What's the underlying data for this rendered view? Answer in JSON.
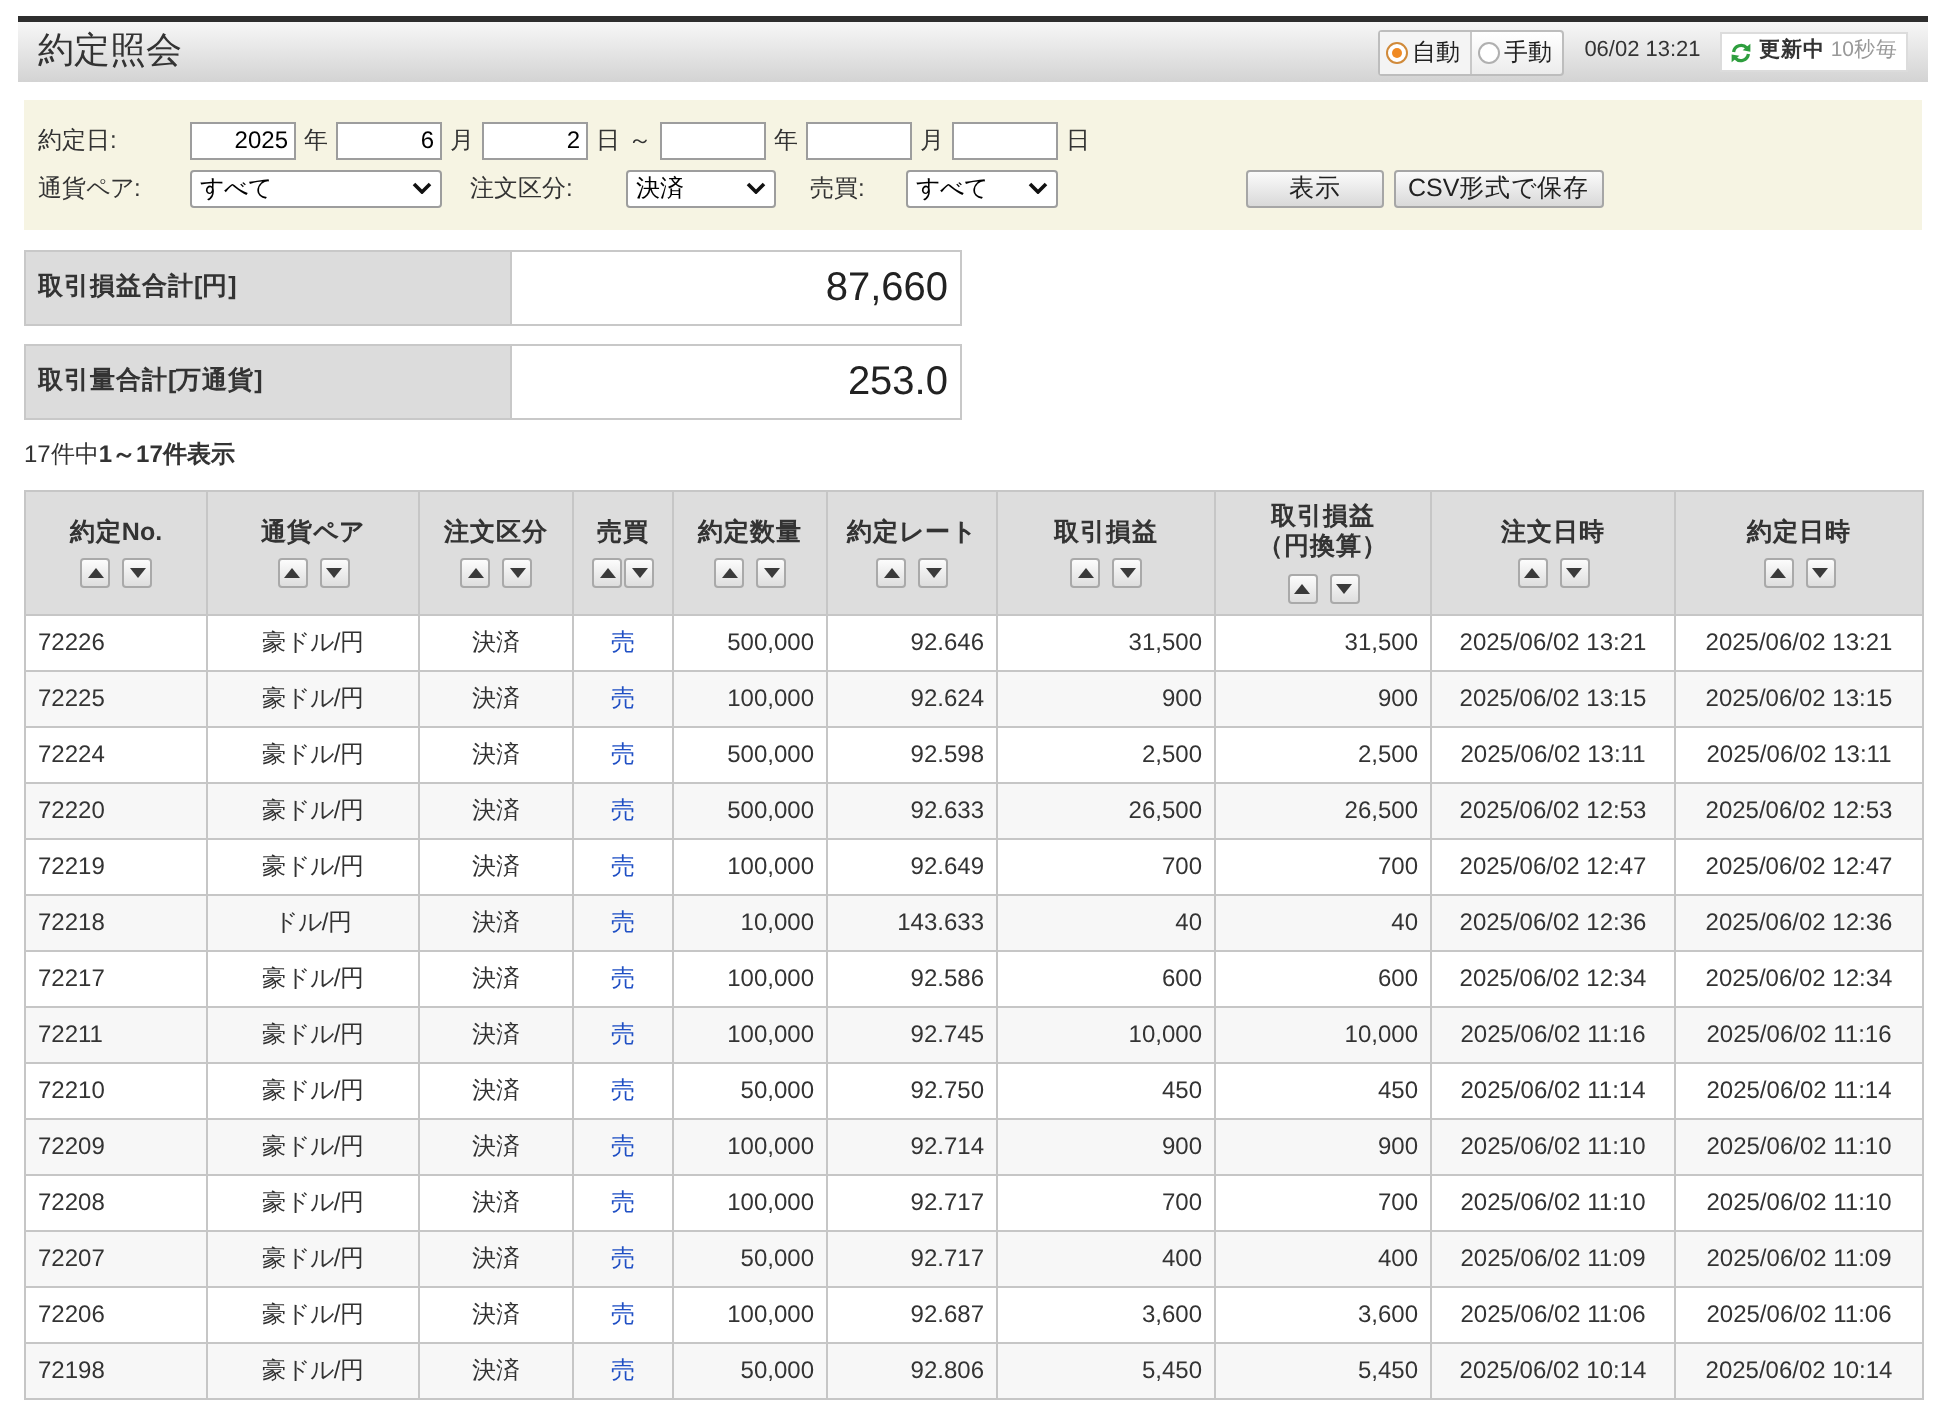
{
  "header": {
    "title": "約定照会",
    "update_modes": [
      {
        "label": "自動",
        "selected": true
      },
      {
        "label": "手動",
        "selected": false
      }
    ],
    "time": "06/02 13:21",
    "refresh": {
      "status": "更新中",
      "interval": "10秒毎"
    }
  },
  "filter": {
    "date_label": "約定日:",
    "date_from": [
      {
        "value": "2025",
        "unit": "年"
      },
      {
        "value": "6",
        "unit": "月"
      },
      {
        "value": "2",
        "unit": "日"
      }
    ],
    "range_separator": "～",
    "date_to": [
      {
        "unit": "年"
      },
      {
        "unit": "月"
      },
      {
        "unit": "日"
      }
    ],
    "dropdowns": [
      {
        "label": "通貨ペア:",
        "value": "すべて"
      },
      {
        "label": "注文区分:",
        "value": "決済"
      },
      {
        "label": "売買:",
        "value": "すべて"
      }
    ],
    "buttons": [
      "表示",
      "CSV形式で保存"
    ]
  },
  "summary": [
    {
      "label": "取引損益合計[円]",
      "value": "87,660"
    },
    {
      "label": "取引量合計[万通貨]",
      "value": "253.0"
    }
  ],
  "result_count": "17件中**1～17件表示**",
  "table": {
    "columns": [
      {
        "label": "約定No."
      },
      {
        "label": "通貨ペア"
      },
      {
        "label": "注文区分"
      },
      {
        "label": "売買"
      },
      {
        "label": "約定数量"
      },
      {
        "label": "約定レート"
      },
      {
        "label": "取引損益"
      },
      {
        "label": "取引損益",
        "sublabel": "（円換算）"
      },
      {
        "label": "注文日時"
      },
      {
        "label": "約定日時"
      }
    ],
    "rows": [
      [
        "72226",
        "豪ドル/円",
        "決済",
        "売",
        "500,000",
        "92.646",
        "31,500",
        "31,500",
        "2025/06/02 13:21",
        "2025/06/02 13:21"
      ],
      [
        "72225",
        "豪ドル/円",
        "決済",
        "売",
        "100,000",
        "92.624",
        "900",
        "900",
        "2025/06/02 13:15",
        "2025/06/02 13:15"
      ],
      [
        "72224",
        "豪ドル/円",
        "決済",
        "売",
        "500,000",
        "92.598",
        "2,500",
        "2,500",
        "2025/06/02 13:11",
        "2025/06/02 13:11"
      ],
      [
        "72220",
        "豪ドル/円",
        "決済",
        "売",
        "500,000",
        "92.633",
        "26,500",
        "26,500",
        "2025/06/02 12:53",
        "2025/06/02 12:53"
      ],
      [
        "72219",
        "豪ドル/円",
        "決済",
        "売",
        "100,000",
        "92.649",
        "700",
        "700",
        "2025/06/02 12:47",
        "2025/06/02 12:47"
      ],
      [
        "72218",
        "ドル/円",
        "決済",
        "売",
        "10,000",
        "143.633",
        "40",
        "40",
        "2025/06/02 12:36",
        "2025/06/02 12:36"
      ],
      [
        "72217",
        "豪ドル/円",
        "決済",
        "売",
        "100,000",
        "92.586",
        "600",
        "600",
        "2025/06/02 12:34",
        "2025/06/02 12:34"
      ],
      [
        "72211",
        "豪ドル/円",
        "決済",
        "売",
        "100,000",
        "92.745",
        "10,000",
        "10,000",
        "2025/06/02 11:16",
        "2025/06/02 11:16"
      ],
      [
        "72210",
        "豪ドル/円",
        "決済",
        "売",
        "50,000",
        "92.750",
        "450",
        "450",
        "2025/06/02 11:14",
        "2025/06/02 11:14"
      ],
      [
        "72209",
        "豪ドル/円",
        "決済",
        "売",
        "100,000",
        "92.714",
        "900",
        "900",
        "2025/06/02 11:10",
        "2025/06/02 11:10"
      ],
      [
        "72208",
        "豪ドル/円",
        "決済",
        "売",
        "100,000",
        "92.717",
        "700",
        "700",
        "2025/06/02 11:10",
        "2025/06/02 11:10"
      ],
      [
        "72207",
        "豪ドル/円",
        "決済",
        "売",
        "50,000",
        "92.717",
        "400",
        "400",
        "2025/06/02 11:09",
        "2025/06/02 11:09"
      ],
      [
        "72206",
        "豪ドル/円",
        "決済",
        "売",
        "100,000",
        "92.687",
        "3,600",
        "3,600",
        "2025/06/02 11:06",
        "2025/06/02 11:06"
      ],
      [
        "72198",
        "豪ドル/円",
        "決済",
        "売",
        "50,000",
        "92.806",
        "5,450",
        "5,450",
        "2025/06/02 10:14",
        "2025/06/02 10:14"
      ]
    ]
  }
}
